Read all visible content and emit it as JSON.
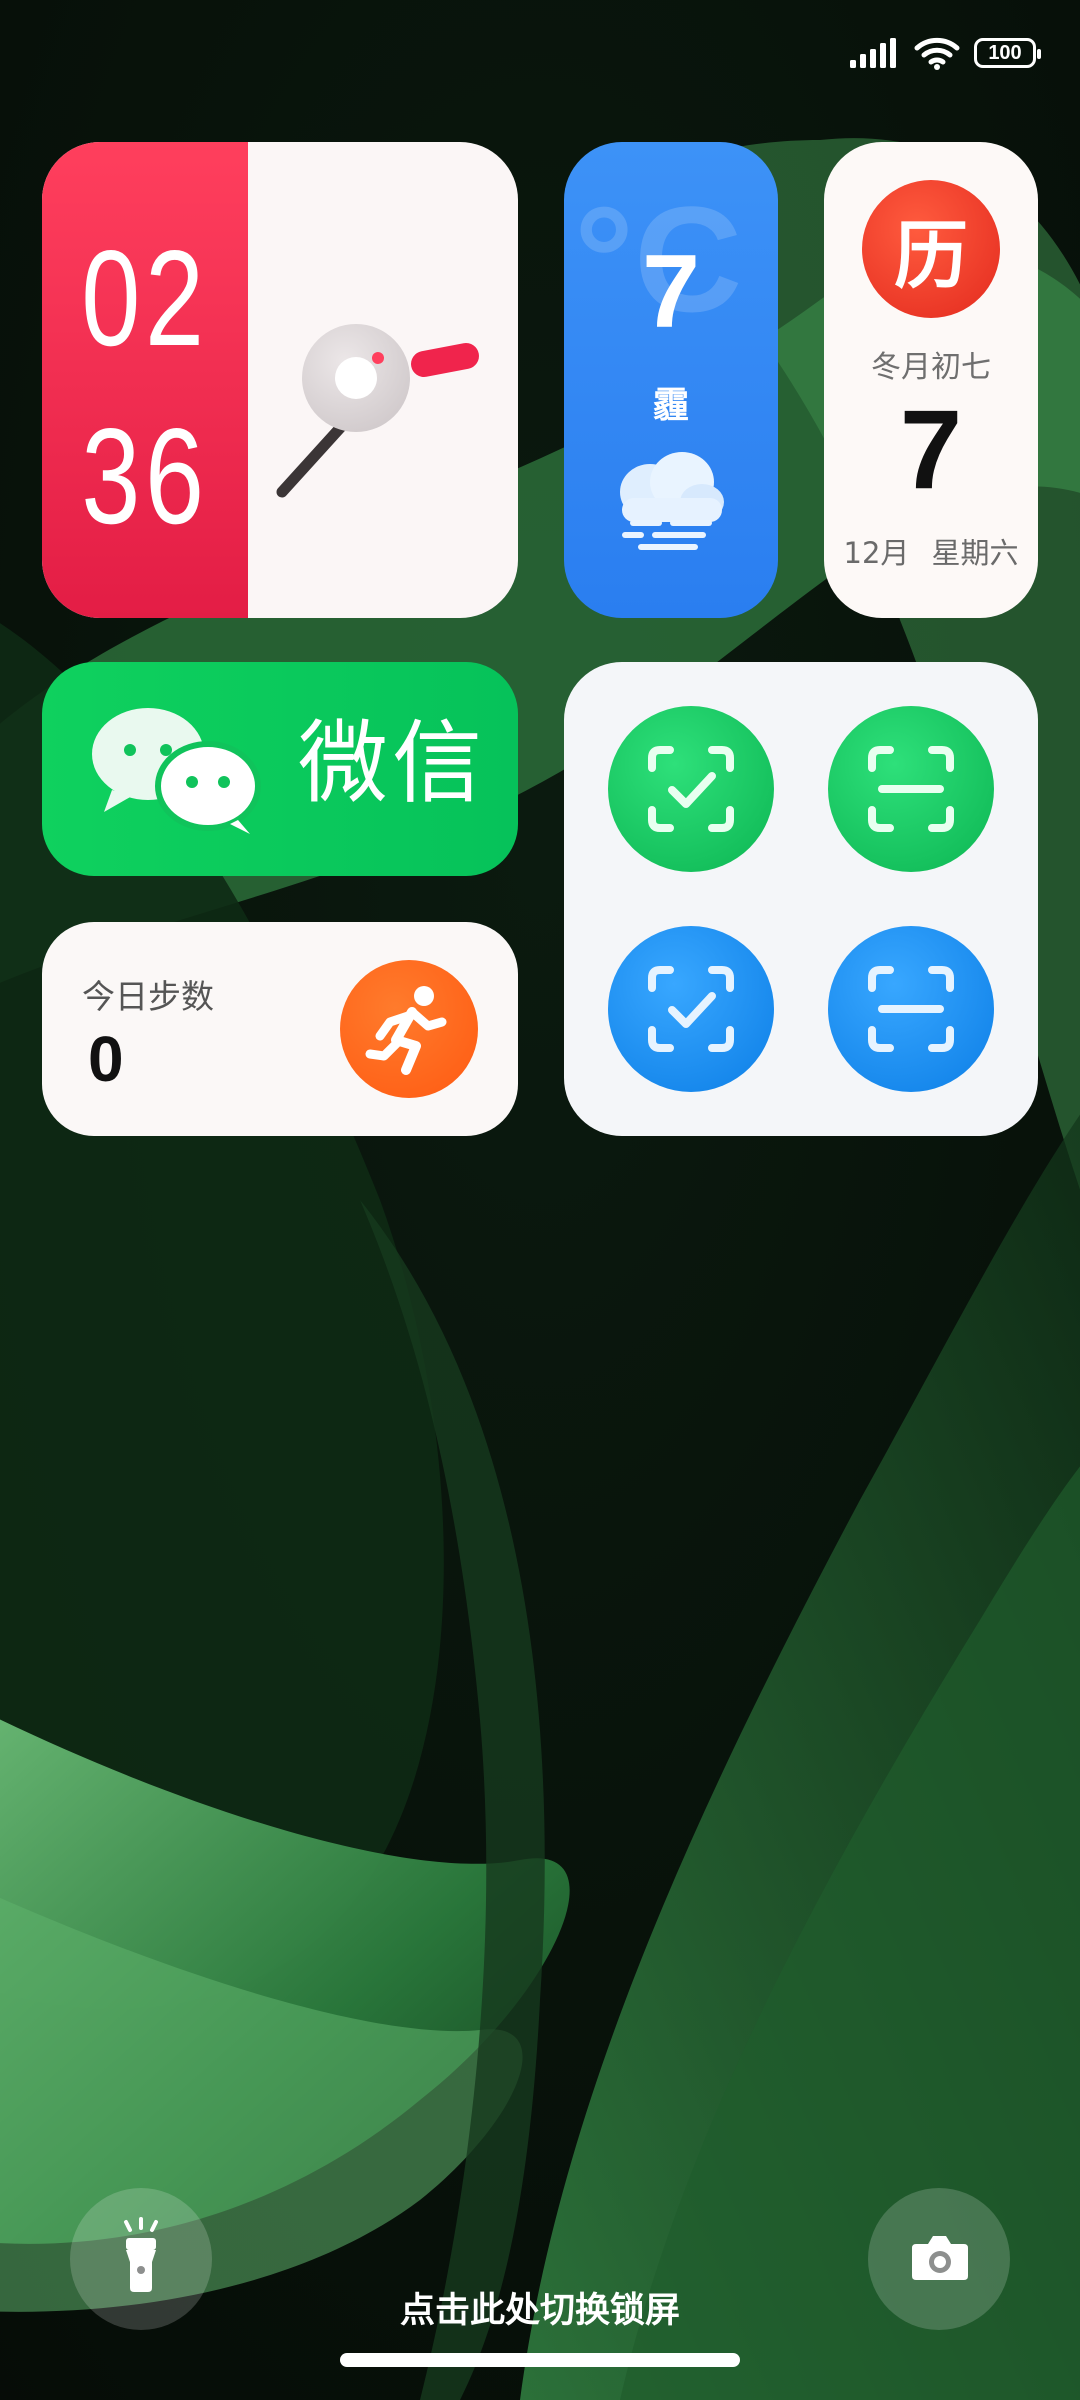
{
  "status_bar": {
    "battery_level": "100",
    "signal_icon": "cellular-signal-icon",
    "wifi_icon": "wifi-icon"
  },
  "clock_widget": {
    "hour": "02",
    "minute": "36",
    "accent_color": "#ff3f5d"
  },
  "weather_widget": {
    "temperature": "7",
    "unit_glyph": "°C",
    "condition": "霾",
    "icon": "haze-cloud-icon",
    "accent_color": "#3d92f7"
  },
  "calendar_widget": {
    "badge": "历",
    "lunar_date": "冬月初七",
    "day": "7",
    "month": "12月",
    "weekday": "星期六"
  },
  "wechat_widget": {
    "label": "微信",
    "icon": "wechat-bubbles-icon"
  },
  "steps_widget": {
    "title": "今日步数",
    "count": "0",
    "icon": "running-person-icon"
  },
  "scan_widget": {
    "buttons": [
      "scan-check-icon",
      "scan-icon",
      "scan-check-icon",
      "scan-icon"
    ]
  },
  "bottom": {
    "flashlight_icon": "flashlight-icon",
    "camera_icon": "camera-icon",
    "hint": "点击此处切换锁屏"
  }
}
